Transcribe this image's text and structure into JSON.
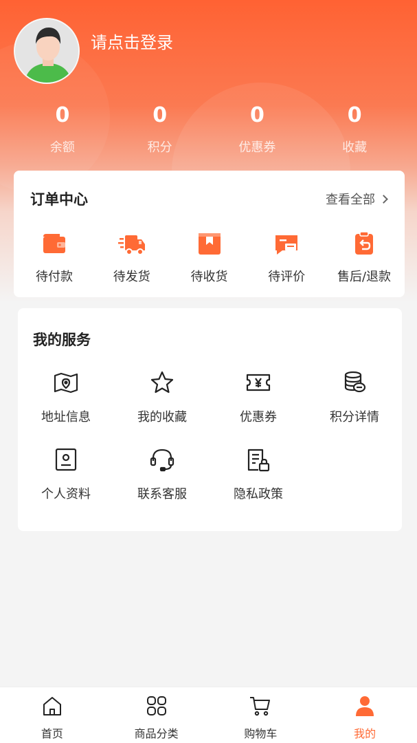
{
  "profile": {
    "login_prompt": "请点击登录"
  },
  "stats": [
    {
      "value": "0",
      "label": "余额"
    },
    {
      "value": "0",
      "label": "积分"
    },
    {
      "value": "0",
      "label": "优惠券"
    },
    {
      "value": "0",
      "label": "收藏"
    }
  ],
  "orders": {
    "title": "订单中心",
    "view_all": "查看全部",
    "items": [
      {
        "label": "待付款",
        "icon": "wallet-icon"
      },
      {
        "label": "待发货",
        "icon": "truck-icon"
      },
      {
        "label": "待收货",
        "icon": "package-icon"
      },
      {
        "label": "待评价",
        "icon": "review-icon"
      },
      {
        "label": "售后/退款",
        "icon": "refund-icon"
      }
    ]
  },
  "services": {
    "title": "我的服务",
    "items": [
      {
        "label": "地址信息",
        "icon": "map-icon"
      },
      {
        "label": "我的收藏",
        "icon": "star-icon"
      },
      {
        "label": "优惠券",
        "icon": "coupon-icon"
      },
      {
        "label": "积分详情",
        "icon": "coins-icon"
      },
      {
        "label": "个人资料",
        "icon": "profile-card-icon"
      },
      {
        "label": "联系客服",
        "icon": "headset-icon"
      },
      {
        "label": "隐私政策",
        "icon": "privacy-doc-icon"
      }
    ]
  },
  "tabbar": {
    "active_color": "#ff6a35",
    "items": [
      {
        "label": "首页",
        "icon": "home-icon"
      },
      {
        "label": "商品分类",
        "icon": "category-icon"
      },
      {
        "label": "购物车",
        "icon": "cart-icon"
      },
      {
        "label": "我的",
        "icon": "user-icon",
        "active": true
      }
    ]
  },
  "colors": {
    "accent": "#ff6233",
    "icon_orange": "#ff6a35"
  }
}
